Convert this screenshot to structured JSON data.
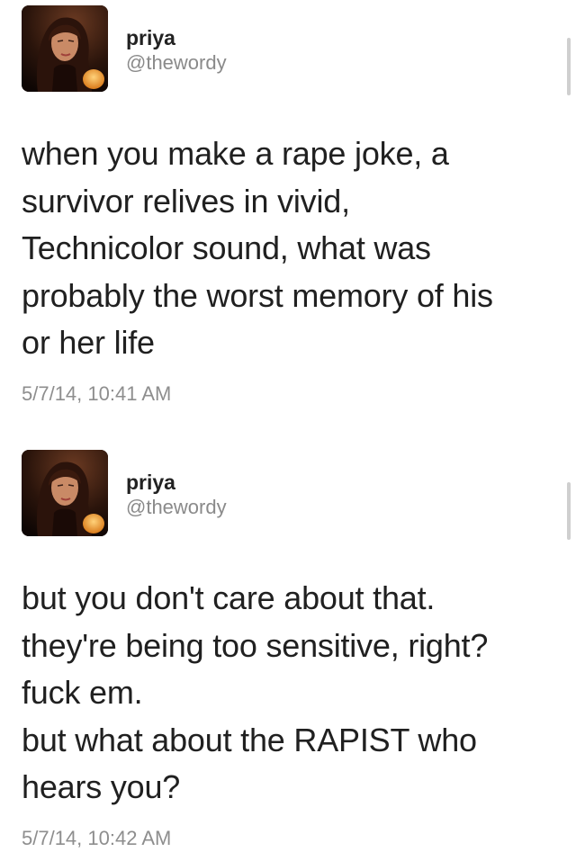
{
  "tweets": [
    {
      "display_name": "priya",
      "handle": "@thewordy",
      "text_lines": [
        "when you make a rape joke, a",
        "survivor relives in vivid,",
        "Technicolor sound, what was",
        "probably the worst memory of his",
        "or her life"
      ],
      "timestamp": "5/7/14, 10:41 AM"
    },
    {
      "display_name": "priya",
      "handle": "@thewordy",
      "text_lines": [
        "but you don't care about that.",
        "they're being too sensitive, right?",
        "fuck em.",
        "but what about the RAPIST who",
        "hears you?"
      ],
      "timestamp": "5/7/14, 10:42 AM"
    }
  ],
  "icons": {
    "avatar": "profile-photo-icon"
  },
  "colors": {
    "text": "#202020",
    "handle": "#8a8a8a",
    "timestamp": "#8e8e8e",
    "background": "#ffffff"
  }
}
